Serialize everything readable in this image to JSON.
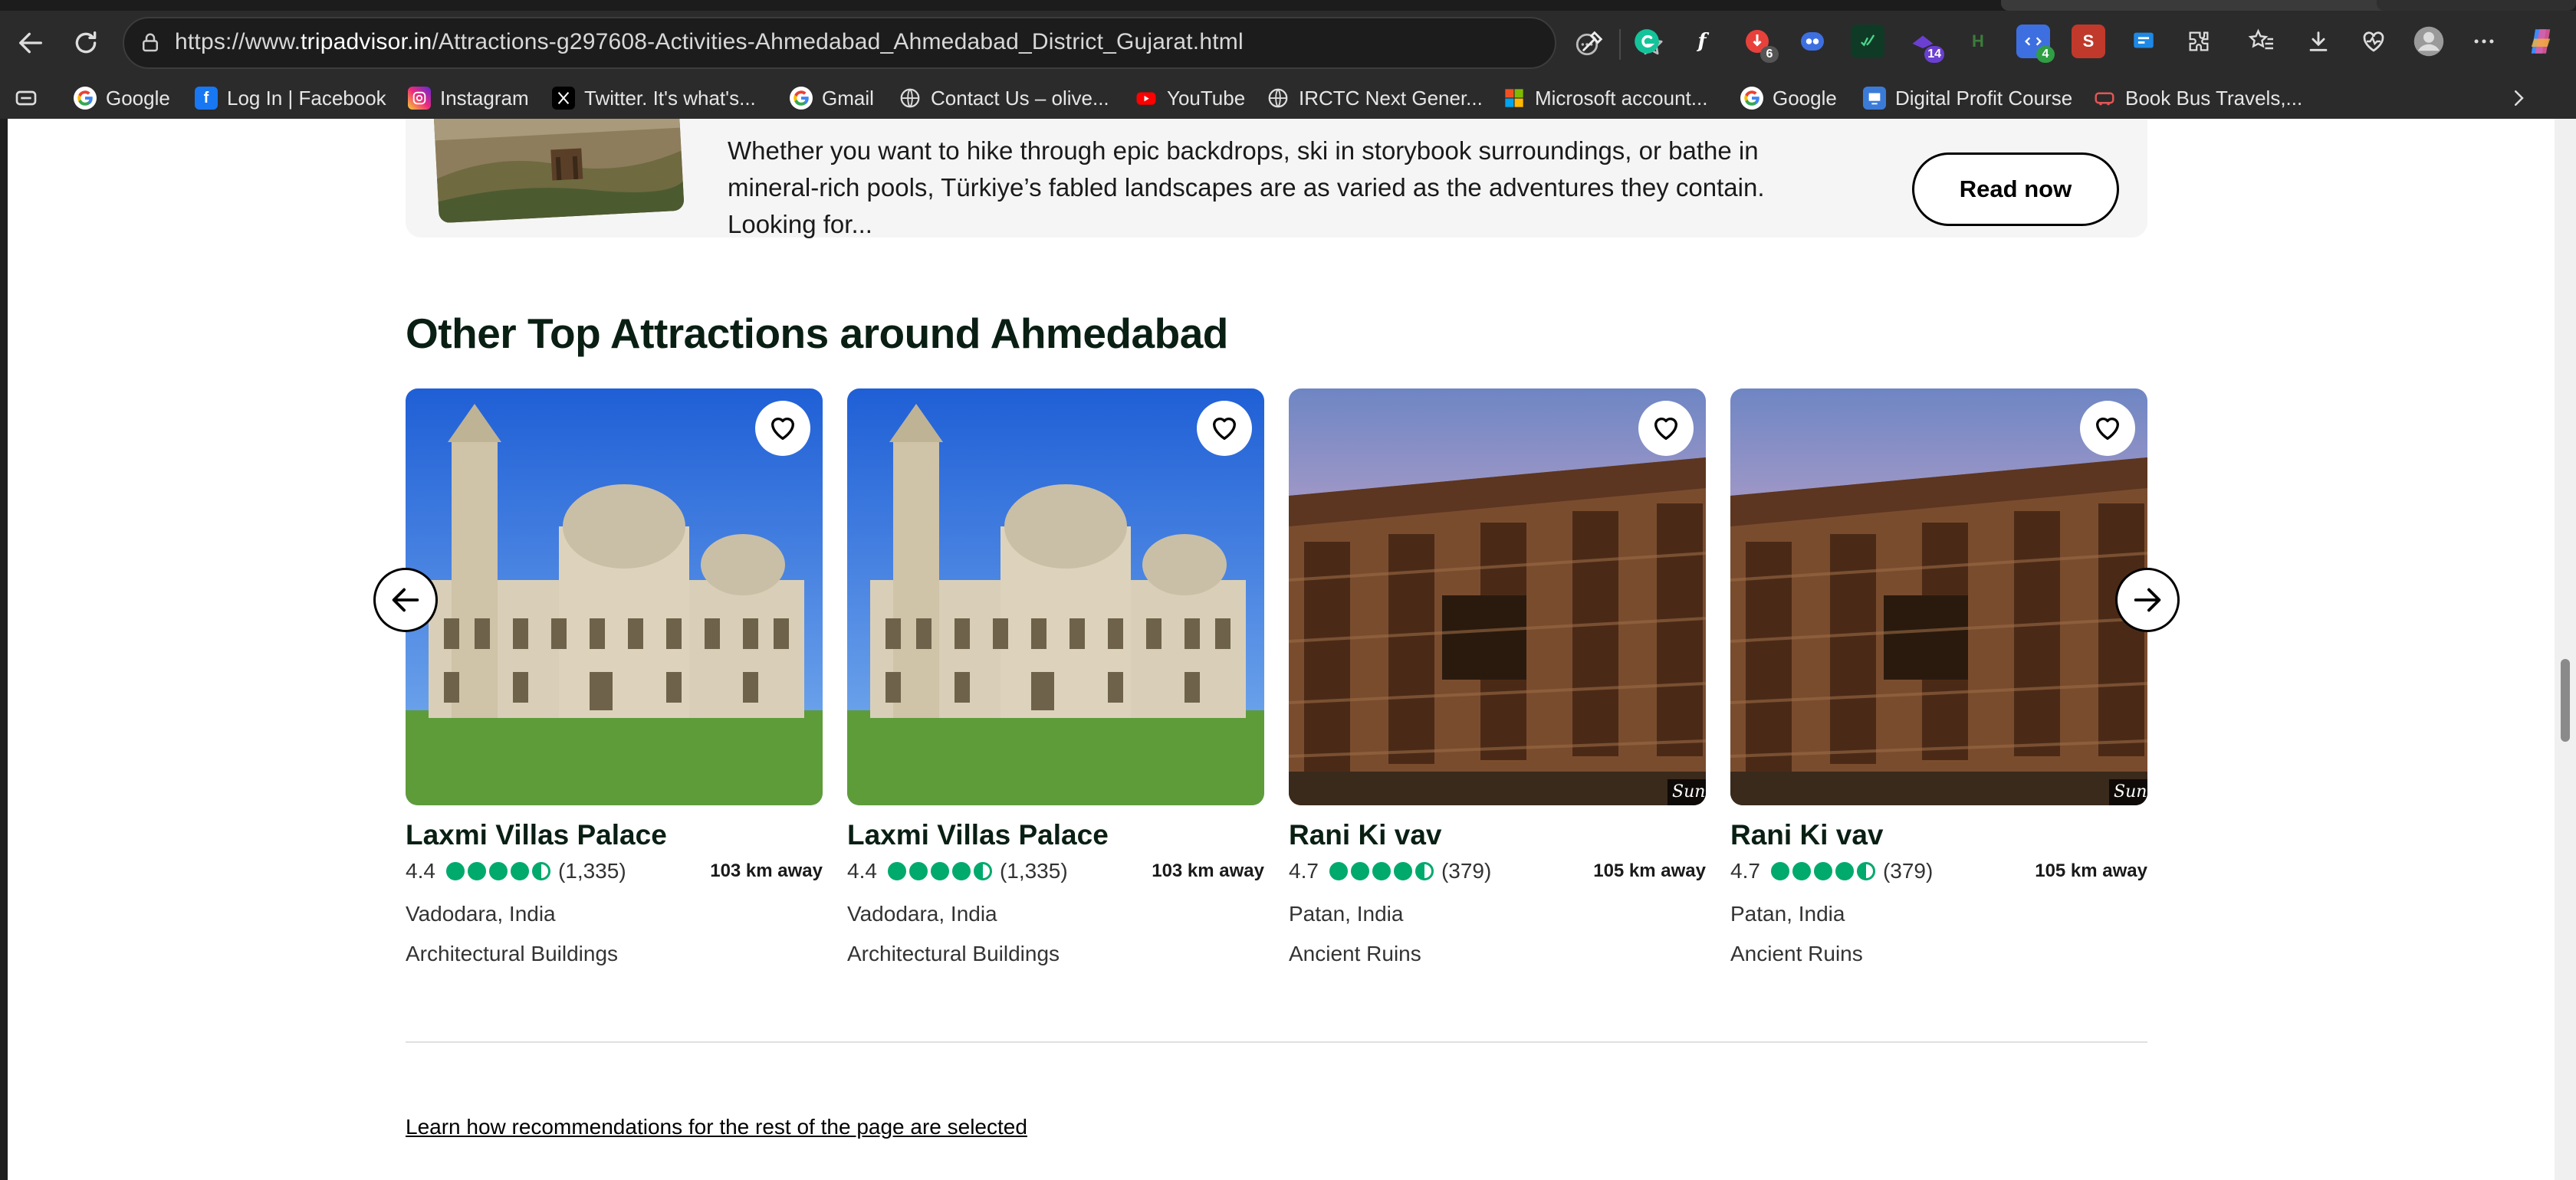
{
  "browser": {
    "url_prefix": "https://www.",
    "url_host": "tripadvisor.in",
    "url_path": "/Attractions-g297608-Activities-Ahmedabad_Ahmedabad_District_Gujarat.html",
    "extension_badges": [
      "6",
      "4",
      "14"
    ],
    "ext_labels": {
      "f": "f",
      "h": "H",
      "s": "S"
    }
  },
  "bookmarks": [
    {
      "label": "Google",
      "icon": "google-icon",
      "color": "#ffffff"
    },
    {
      "label": "Log In | Facebook",
      "icon": "facebook-icon",
      "color": "#1877f2"
    },
    {
      "label": "Instagram",
      "icon": "instagram-icon",
      "color": "#d6249f"
    },
    {
      "label": "Twitter. It's what's...",
      "icon": "x-icon",
      "color": "#000000"
    },
    {
      "label": "Gmail",
      "icon": "google-icon",
      "color": "#ffffff"
    },
    {
      "label": "Contact Us – olive...",
      "icon": "globe-icon",
      "color": "#2b2b2b"
    },
    {
      "label": "YouTube",
      "icon": "youtube-icon",
      "color": "#ff0000"
    },
    {
      "label": "IRCTC Next Gener...",
      "icon": "globe-icon",
      "color": "#2b2b2b"
    },
    {
      "label": "Microsoft account...",
      "icon": "microsoft-icon",
      "color": "#2b2b2b"
    },
    {
      "label": "Google",
      "icon": "google-icon",
      "color": "#ffffff"
    },
    {
      "label": "Digital Profit Course",
      "icon": "course-icon",
      "color": "#3b7bd8"
    },
    {
      "label": "Book Bus Travels,...",
      "icon": "bus-icon",
      "color": "#d84343"
    }
  ],
  "article": {
    "description": "Whether you want to hike through epic backdrops, ski in storybook surroundings, or bathe in mineral-rich pools, Türkiye’s fabled landscapes are as varied as the adventures they contain. Looking for...",
    "button_label": "Read now"
  },
  "section": {
    "title": "Other Top Attractions around Ahmedabad"
  },
  "attractions": [
    {
      "name": "Laxmi Villas Palace",
      "score": "4.4",
      "bubbles": 4.5,
      "reviews": "(1,335)",
      "distance": "103 km away",
      "location": "Vadodara, India",
      "category": "Architectural Buildings",
      "image": "palace"
    },
    {
      "name": "Laxmi Villas Palace",
      "score": "4.4",
      "bubbles": 4.5,
      "reviews": "(1,335)",
      "distance": "103 km away",
      "location": "Vadodara, India",
      "category": "Architectural Buildings",
      "image": "palace"
    },
    {
      "name": "Rani Ki vav",
      "score": "4.7",
      "bubbles": 4.5,
      "reviews": "(379)",
      "distance": "105 km away",
      "location": "Patan, India",
      "category": "Ancient Ruins",
      "image": "stepwell",
      "watermark": "Sun"
    },
    {
      "name": "Rani Ki vav",
      "score": "4.7",
      "bubbles": 4.5,
      "reviews": "(379)",
      "distance": "105 km away",
      "location": "Patan, India",
      "category": "Ancient Ruins",
      "image": "stepwell",
      "watermark": "Sun"
    }
  ],
  "footer": {
    "learn_link": "Learn how recommendations for the rest of the page are selected"
  },
  "colors": {
    "rating_green": "#00aa6c",
    "title_dark": "#0a1f14"
  }
}
